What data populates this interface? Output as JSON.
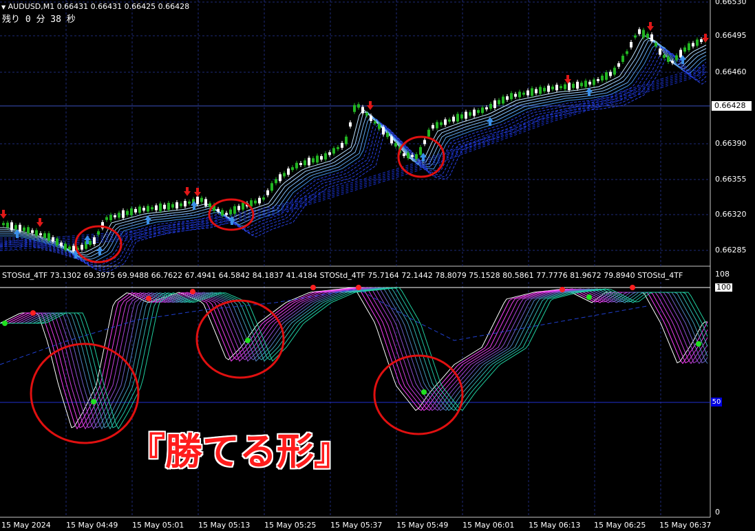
{
  "header": {
    "symbol_line": "AUDUSD,M1  0.66431 0.66431 0.66425 0.66428",
    "countdown": "残り 0 分 38 秒"
  },
  "price_axis": {
    "labels": [
      "0.66530",
      "0.66495",
      "0.66460",
      "0.66428",
      "0.66390",
      "0.66355",
      "0.66320",
      "0.66285"
    ],
    "current_price": "0.66428"
  },
  "indicator": {
    "values_line": "STOStd_4TF 73.1302 69.3975 69.9488 66.7622 67.4941 64.5842 84.1837 41.4184  STOStd_4TF 75.7164 72.1442 78.8079 75.1528 80.5861 77.7776 81.9672 79.8940  STOStd_4TF",
    "scale_top": "108",
    "scale_100": "100",
    "level_50": "50",
    "scale_bottom": "0"
  },
  "time_axis": {
    "labels": [
      "15 May 2024",
      "15 May 04:49",
      "15 May 05:01",
      "15 May 05:13",
      "15 May 05:25",
      "15 May 05:37",
      "15 May 05:49",
      "15 May 06:01",
      "15 May 06:13",
      "15 May 06:25",
      "15 May 06:37"
    ]
  },
  "overlay_text": "『勝てる形』",
  "colors": {
    "background": "#000000",
    "bull_candle": "#22b522",
    "bear_candle": "#ffffff",
    "grid": "#1e2a78",
    "annotation_circle": "#e01010",
    "up_arrow": "#3a8fe8",
    "down_arrow": "#e01818"
  },
  "icons": {
    "menu": "triangle-down-icon",
    "buy_signal": "up-arrow-icon",
    "sell_signal": "down-arrow-icon"
  }
}
